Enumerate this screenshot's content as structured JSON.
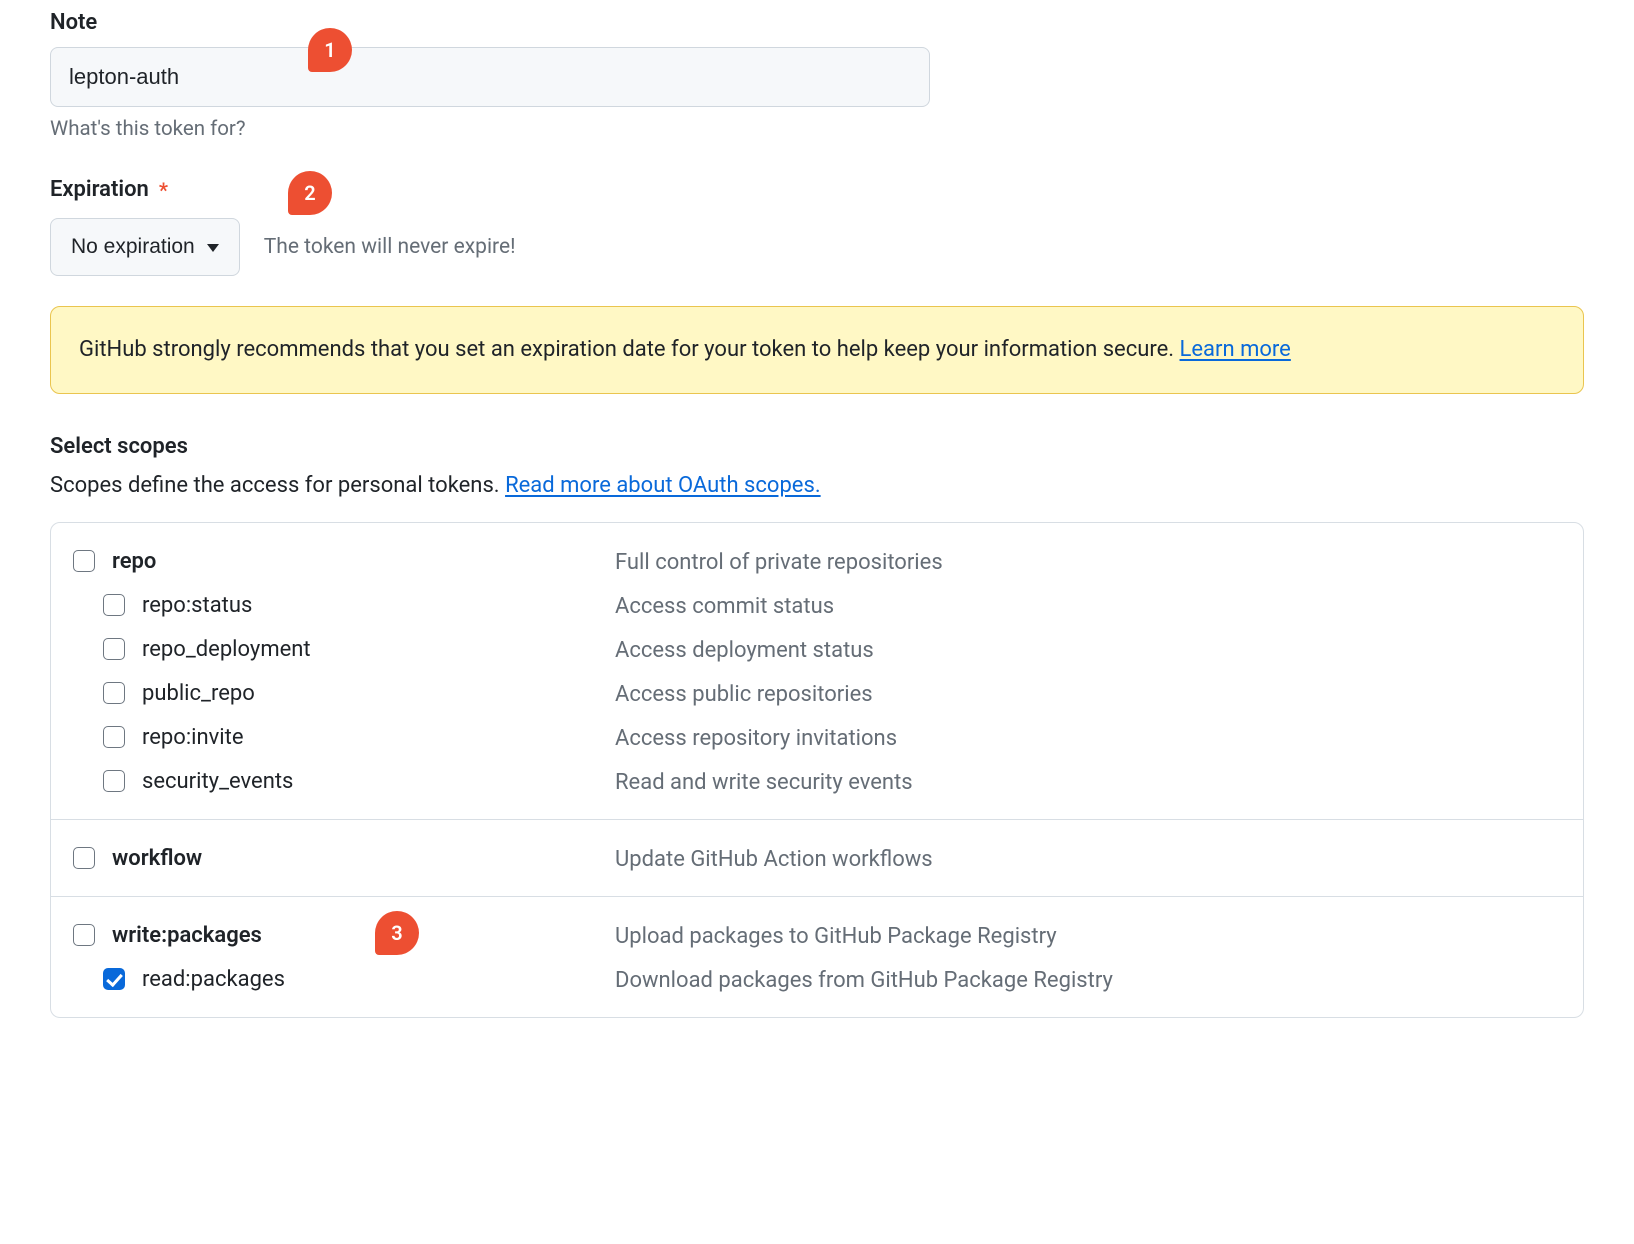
{
  "note": {
    "label": "Note",
    "value": "lepton-auth",
    "helper": "What's this token for?"
  },
  "expiration": {
    "label": "Expiration",
    "selected": "No expiration",
    "hint": "The token will never expire!",
    "banner_text": "GitHub strongly recommends that you set an expiration date for your token to help keep your information secure. ",
    "banner_link": "Learn more"
  },
  "scopes": {
    "heading": "Select scopes",
    "description_pre": "Scopes define the access for personal tokens. ",
    "description_link": "Read more about OAuth scopes.",
    "groups": [
      {
        "name": "repo",
        "desc": "Full control of private repositories",
        "checked": false,
        "subs": [
          {
            "name": "repo:status",
            "desc": "Access commit status",
            "checked": false
          },
          {
            "name": "repo_deployment",
            "desc": "Access deployment status",
            "checked": false
          },
          {
            "name": "public_repo",
            "desc": "Access public repositories",
            "checked": false
          },
          {
            "name": "repo:invite",
            "desc": "Access repository invitations",
            "checked": false
          },
          {
            "name": "security_events",
            "desc": "Read and write security events",
            "checked": false
          }
        ]
      },
      {
        "name": "workflow",
        "desc": "Update GitHub Action workflows",
        "checked": false,
        "subs": []
      },
      {
        "name": "write:packages",
        "desc": "Upload packages to GitHub Package Registry",
        "checked": false,
        "subs": [
          {
            "name": "read:packages",
            "desc": "Download packages from GitHub Package Registry",
            "checked": true
          }
        ]
      }
    ]
  },
  "callouts": {
    "one": "1",
    "two": "2",
    "three": "3"
  }
}
